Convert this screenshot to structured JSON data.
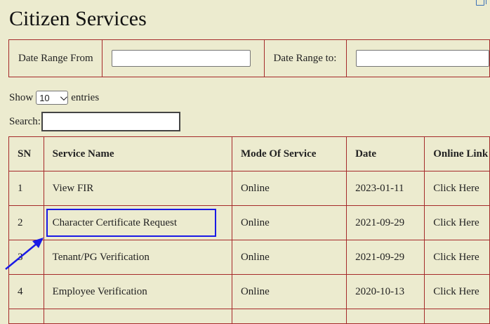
{
  "page": {
    "title": "Citizen Services"
  },
  "filter": {
    "from_label": "Date Range From",
    "from_value": "",
    "to_label": "Date Range to:",
    "to_value": ""
  },
  "length": {
    "show_label": "Show",
    "selected": "10",
    "entries_label": "entries"
  },
  "search": {
    "label": "Search:",
    "value": ""
  },
  "table": {
    "headers": [
      "SN",
      "Service Name",
      "Mode Of Service",
      "Date",
      "Online Link"
    ],
    "rows": [
      {
        "sn": "1",
        "service": "View FIR",
        "mode": "Online",
        "date": "2023-01-11",
        "link": "Click Here"
      },
      {
        "sn": "2",
        "service": "Character Certificate Request",
        "mode": "Online",
        "date": "2021-09-29",
        "link": "Click Here"
      },
      {
        "sn": "3",
        "service": "Tenant/PG Verification",
        "mode": "Online",
        "date": "2021-09-29",
        "link": "Click Here"
      },
      {
        "sn": "4",
        "service": "Employee Verification",
        "mode": "Online",
        "date": "2020-10-13",
        "link": "Click Here"
      }
    ]
  },
  "annotation": {
    "highlight_color": "#1a1ae6",
    "arrow_icon": "arrow-icon"
  }
}
